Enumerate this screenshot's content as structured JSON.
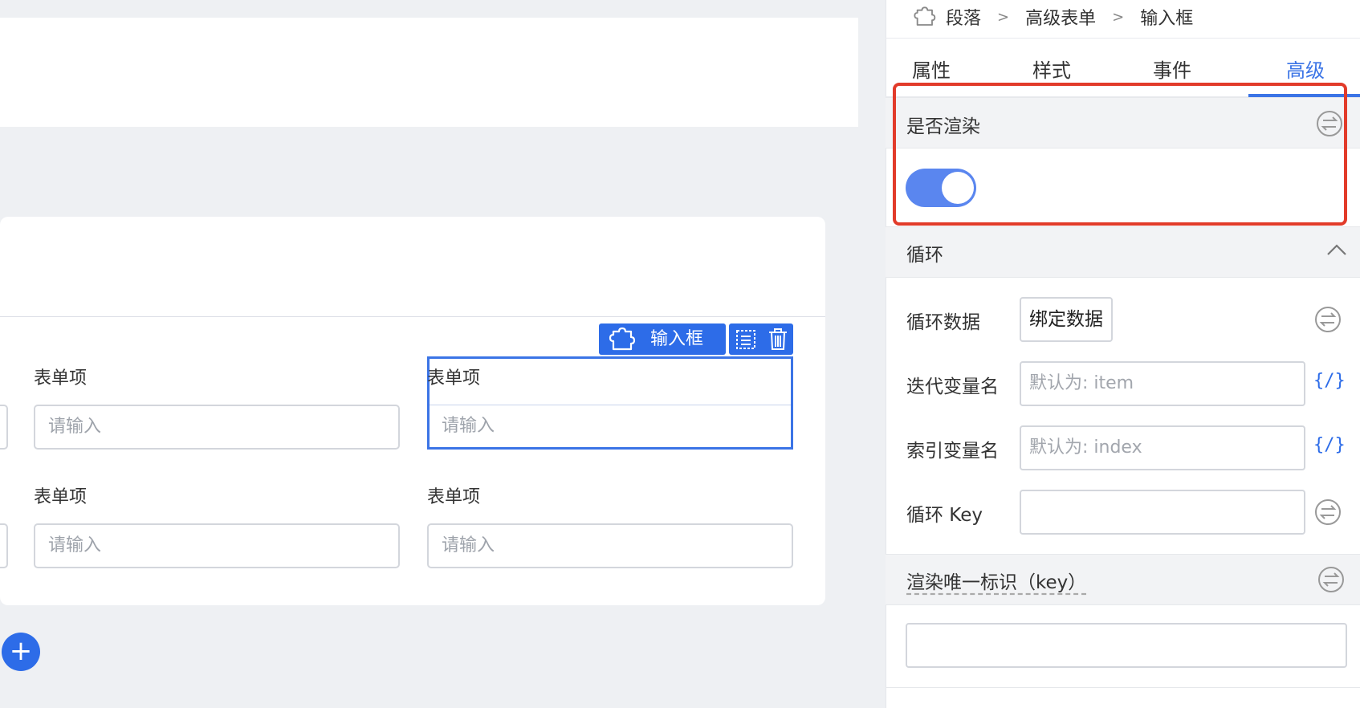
{
  "canvas": {
    "form_items": [
      {
        "label": "表单项",
        "placeholder": "请输入"
      },
      {
        "label": "表单项",
        "placeholder": "请输入"
      },
      {
        "label": "表单项",
        "placeholder": "请输入"
      },
      {
        "label": "表单项",
        "placeholder": "请输入"
      }
    ],
    "selected_tag": "输入框",
    "add_button": "+"
  },
  "panel": {
    "breadcrumb": [
      "段落",
      "高级表单",
      "输入框"
    ],
    "breadcrumb_sep": ">",
    "tabs": [
      "属性",
      "样式",
      "事件",
      "高级"
    ],
    "active_tab": "高级",
    "render_section": {
      "title": "是否渲染",
      "enabled": true
    },
    "loop_section": {
      "title": "循环",
      "loop_data_label": "循环数据",
      "bind_button": "绑定数据",
      "iter_var_label": "迭代变量名",
      "iter_var_placeholder": "默认为: item",
      "index_var_label": "索引变量名",
      "index_var_placeholder": "默认为: index",
      "loop_key_label": "循环 Key",
      "code_icon": "{/}"
    },
    "key_section": {
      "title": "渲染唯一标识（key）"
    }
  },
  "colors": {
    "accent": "#2d6ce8",
    "highlight": "#e23b2a",
    "toggle_on": "#5a86ef"
  }
}
